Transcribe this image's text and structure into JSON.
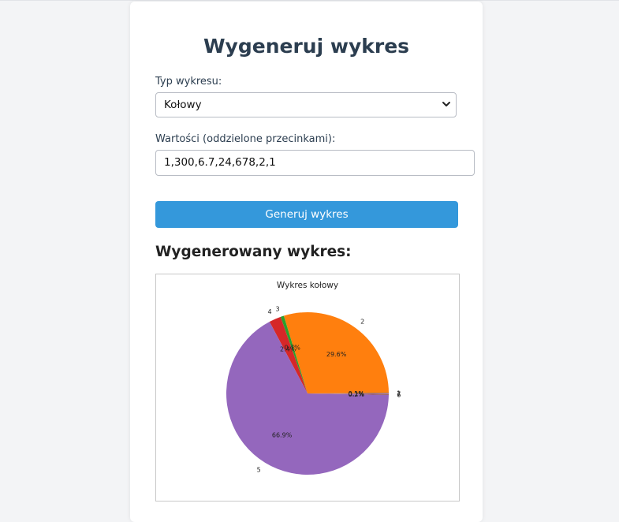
{
  "form": {
    "title": "Wygeneruj wykres",
    "chart_type_label": "Typ wykresu:",
    "chart_type_value": "Kołowy",
    "values_label": "Wartości (oddzielone przecinkami):",
    "values_input": "1,300,6.7,24,678,2,1",
    "submit_label": "Generuj wykres"
  },
  "result": {
    "heading": "Wygenerowany wykres:"
  },
  "chart_data": {
    "type": "pie",
    "title": "Wykres kołowy",
    "categories": [
      "1",
      "2",
      "3",
      "4",
      "5",
      "6",
      "7"
    ],
    "values": [
      1,
      300,
      6.7,
      24,
      678,
      2,
      1
    ],
    "percent_labels": [
      "0.1%",
      "29.6%",
      "0.7%",
      "2.4%",
      "66.9%",
      "0.2%",
      "0.1%"
    ],
    "colors": [
      "#1f77b4",
      "#ff7f0e",
      "#2ca02c",
      "#d62728",
      "#9467bd",
      "#8c564b",
      "#e377c2"
    ]
  }
}
